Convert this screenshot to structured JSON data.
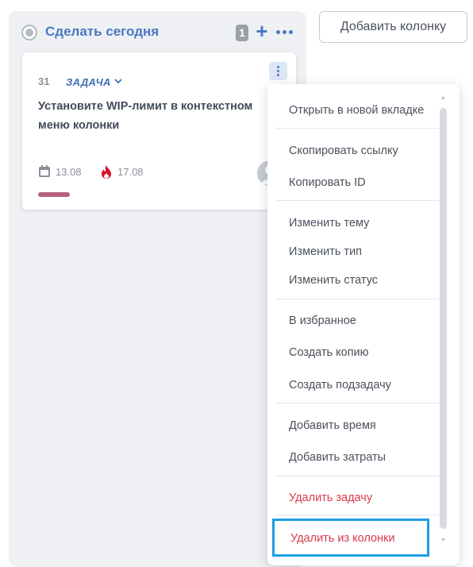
{
  "column": {
    "title": "Сделать сегодня",
    "count": "1",
    "add_icon": "plus-icon",
    "more_icon": "more-horizontal-icon"
  },
  "card": {
    "id": "31",
    "type_label": "ЗАДАЧА",
    "title": "Установите WIP-лимит в контекстном меню колонки",
    "start_date": "13.08",
    "due_date": "17.08",
    "menu_icon": "more-vertical-icon",
    "tag_color": "#b8647e"
  },
  "add_column_label": "Добавить колонку",
  "context_menu": {
    "groups": [
      [
        {
          "label": "Открыть в новой вкладке"
        }
      ],
      [
        {
          "label": "Скопировать ссылку"
        },
        {
          "label": "Копировать ID"
        }
      ],
      [
        {
          "label": "Изменить тему"
        },
        {
          "label": "Изменить тип"
        },
        {
          "label": "Изменить статус"
        }
      ],
      [
        {
          "label": "В избранное"
        },
        {
          "label": "Создать копию"
        },
        {
          "label": "Создать подзадачу"
        }
      ],
      [
        {
          "label": "Добавить время"
        },
        {
          "label": "Добавить затраты"
        }
      ],
      [
        {
          "label": "Удалить задачу"
        }
      ],
      [
        {
          "label": "Удалить из колонки"
        }
      ]
    ]
  },
  "colors": {
    "accent": "#4a78c4",
    "danger": "#d9394c",
    "highlight": "#1a9ee3"
  }
}
